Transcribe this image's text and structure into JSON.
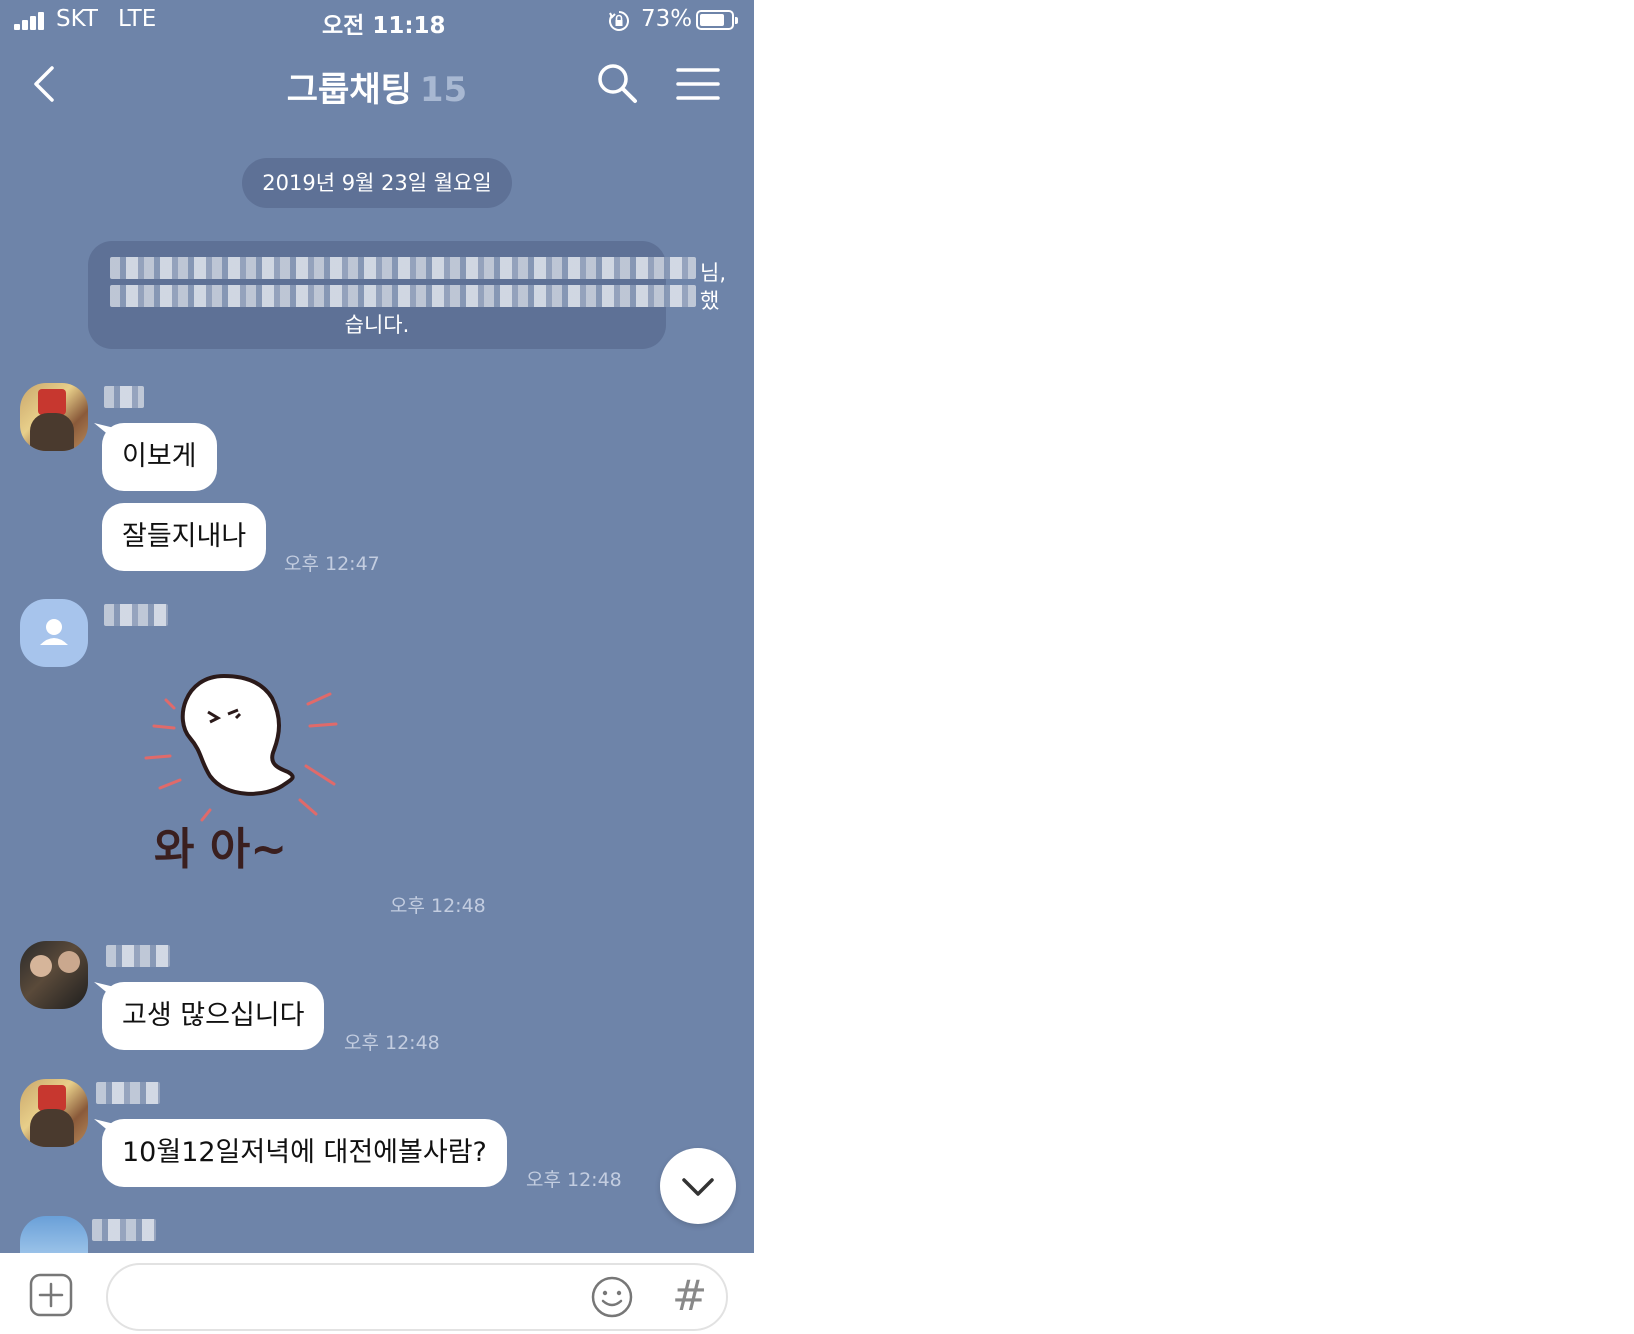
{
  "status_bar": {
    "carrier": "SKT",
    "network": "LTE",
    "time": "오전 11:18",
    "battery": "73%"
  },
  "header": {
    "title": "그룹채팅",
    "member_count": "15",
    "back_icon": "chevron-left-icon",
    "search_icon": "search-icon",
    "menu_icon": "hamburger-menu-icon"
  },
  "date_divider": "2019년 9월 23일 월요일",
  "notice": {
    "visible_tail_line1": "님,",
    "visible_tail_line2": "했",
    "visible_end": "습니다."
  },
  "messages": {
    "m1": {
      "text": "이보게"
    },
    "m2": {
      "text": "잘들지내나",
      "time": "오후 12:47"
    },
    "m3": {
      "sticker_text": "와 아~",
      "time": "오후 12:48"
    },
    "m4": {
      "text": "고생 많으십니다",
      "time": "오후 12:48"
    },
    "m5": {
      "text": "10월12일저녁에 대전에볼사람?",
      "time": "오후 12:48"
    }
  },
  "input_bar": {
    "placeholder": "",
    "add_icon": "plus-square-icon",
    "emoji_icon": "emoticon-icon",
    "hash_label": "#"
  },
  "colors": {
    "chat_background": "#6e84a9",
    "pill_background": "#5e7196",
    "bubble": "#ffffff",
    "timestamp": "#c3cde0"
  }
}
